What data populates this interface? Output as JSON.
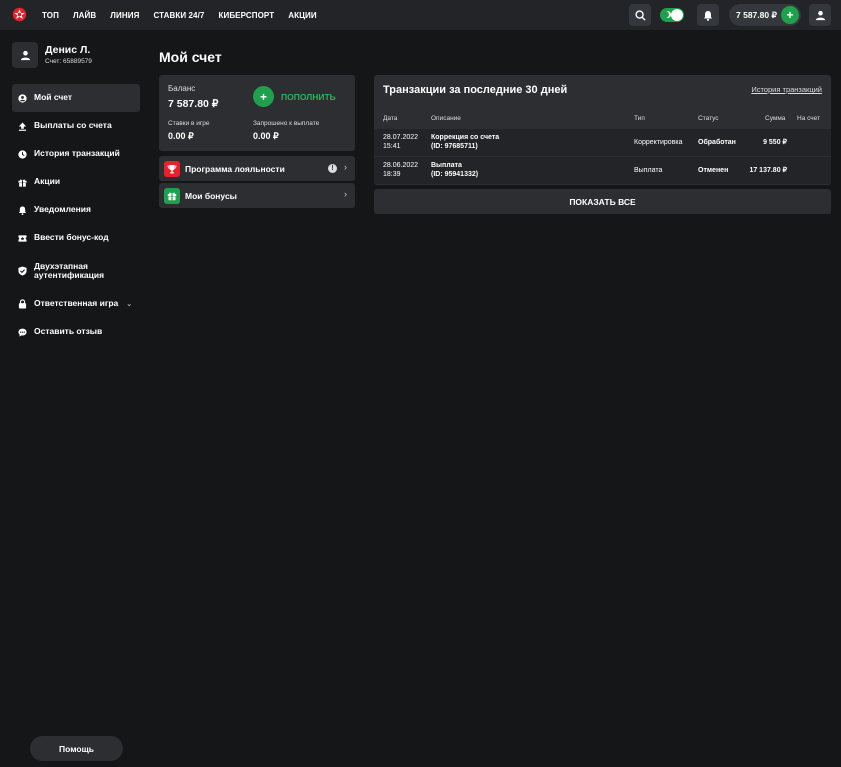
{
  "nav": {
    "items": [
      "ТОП",
      "ЛАЙВ",
      "ЛИНИЯ",
      "СТАВКИ 24/7",
      "КИБЕРСПОРТ",
      "АКЦИИ"
    ]
  },
  "header": {
    "balance": "7 587.80 ₽"
  },
  "user": {
    "name": "Денис Л.",
    "account": "Счет: 65889579"
  },
  "sidebar": {
    "items": [
      {
        "label": "Мой счет",
        "icon": "account-circle-icon"
      },
      {
        "label": "Выплаты со счета",
        "icon": "upload-icon"
      },
      {
        "label": "История транзакций",
        "icon": "clock-icon"
      },
      {
        "label": "Акции",
        "icon": "gift-icon"
      },
      {
        "label": "Уведомления",
        "icon": "bell-icon"
      },
      {
        "label": "Ввести бонус-код",
        "icon": "ticket-icon"
      },
      {
        "label": "Двухэтапная аутентификация",
        "icon": "shield-icon"
      },
      {
        "label": "Ответственная игра",
        "icon": "lock-icon"
      },
      {
        "label": "Оставить отзыв",
        "icon": "chat-icon"
      }
    ]
  },
  "help": "Помощь",
  "page": {
    "title": "Мой счет"
  },
  "balance_card": {
    "label": "Баланс",
    "amount": "7 587.80 ₽",
    "topup": "ПОПОЛНИТЬ",
    "bets_label": "Ставки в игре",
    "bets_value": "0.00 ₽",
    "requested_label": "Запрошено к выплате",
    "requested_value": "0.00 ₽"
  },
  "loyalty": {
    "label": "Программа лояльности"
  },
  "bonuses": {
    "label": "Мои бонусы"
  },
  "transactions": {
    "title": "Транзакции за последние 30 дней",
    "history_link": "История транзакций",
    "columns": [
      "Дата",
      "Описание",
      "Тип",
      "Статус",
      "Сумма",
      "На счет"
    ],
    "rows": [
      {
        "date": "28.07.2022",
        "time": "15:41",
        "desc": "Коррекция со счета",
        "id": "(ID: 97685711)",
        "type": "Корректировка",
        "status": "Обработан",
        "amount": "9 550 ₽",
        "to_account": ""
      },
      {
        "date": "28.06.2022",
        "time": "18:39",
        "desc": "Выплата",
        "id": "(ID: 95941332)",
        "type": "Выплата",
        "status": "Отменен",
        "amount": "17 137.80 ₽",
        "to_account": ""
      }
    ],
    "show_all": "ПОКАЗАТЬ ВСЕ"
  },
  "colors": {
    "accent_green": "#1fa04c",
    "accent_red": "#e8202a",
    "background": "#151618",
    "card": "#2c2e32"
  }
}
